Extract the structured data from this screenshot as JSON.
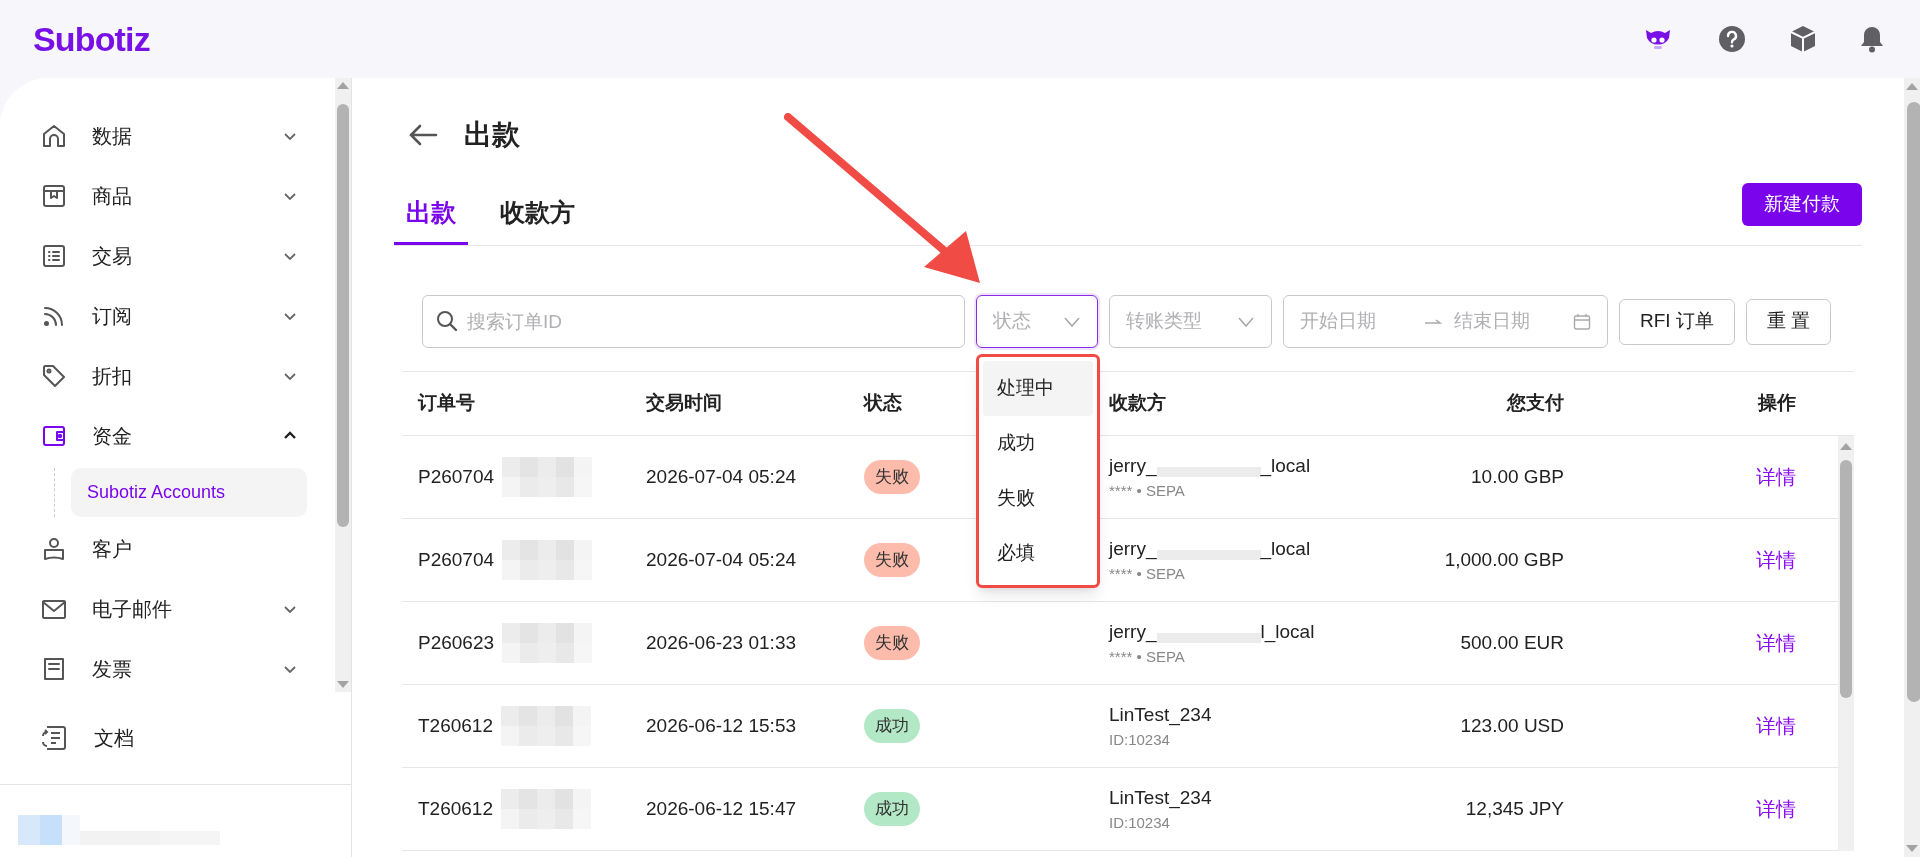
{
  "logo": "Subotiz",
  "sidebar": {
    "items": [
      {
        "label": "数据",
        "expandable": true,
        "expanded": false,
        "active": false
      },
      {
        "label": "商品",
        "expandable": true,
        "expanded": false,
        "active": false
      },
      {
        "label": "交易",
        "expandable": true,
        "expanded": false,
        "active": false
      },
      {
        "label": "订阅",
        "expandable": true,
        "expanded": false,
        "active": false
      },
      {
        "label": "折扣",
        "expandable": true,
        "expanded": false,
        "active": false
      },
      {
        "label": "资金",
        "expandable": true,
        "expanded": true,
        "active": true,
        "children": [
          {
            "label": "Subotiz Accounts",
            "selected": true
          }
        ]
      },
      {
        "label": "客户",
        "expandable": false,
        "active": false
      },
      {
        "label": "电子邮件",
        "expandable": true,
        "expanded": false,
        "active": false
      },
      {
        "label": "发票",
        "expandable": true,
        "expanded": false,
        "active": false
      }
    ],
    "footer_item": "文档"
  },
  "page": {
    "title": "出款",
    "tabs": [
      {
        "label": "出款",
        "selected": true
      },
      {
        "label": "收款方",
        "selected": false
      }
    ],
    "primary_button": "新建付款",
    "filters": {
      "search": {
        "placeholder": "搜索订单ID"
      },
      "status": {
        "placeholder": "状态",
        "open": true,
        "options": [
          {
            "label": "处理中",
            "highlighted": true
          },
          {
            "label": "成功",
            "highlighted": false
          },
          {
            "label": "失败",
            "highlighted": false
          },
          {
            "label": "必填",
            "highlighted": false
          }
        ]
      },
      "transfer_type": {
        "placeholder": "转账类型"
      },
      "date_range": {
        "start_placeholder": "开始日期",
        "end_placeholder": "结束日期"
      },
      "buttons": [
        "RFI 订单",
        "重 置"
      ]
    },
    "table": {
      "columns": [
        "订单号",
        "交易时间",
        "状态",
        "收款方",
        "您支付",
        "操作"
      ],
      "rows": [
        {
          "order_id": "P260704",
          "time": "2026-07-04 05:24",
          "status": {
            "label": "失败",
            "color": "#fdbcab"
          },
          "payee": {
            "parts": [
              "jerry_",
              "_local"
            ],
            "sub": "**** • SEPA"
          },
          "amount": "10.00 GBP",
          "action": "详情"
        },
        {
          "order_id": "P260704",
          "time": "2026-07-04 05:24",
          "status": {
            "label": "失败",
            "color": "#fdbcab"
          },
          "payee": {
            "parts": [
              "jerry_",
              "_local"
            ],
            "sub": "**** • SEPA"
          },
          "amount": "1,000.00 GBP",
          "action": "详情"
        },
        {
          "order_id": "P260623",
          "time": "2026-06-23 01:33",
          "status": {
            "label": "失败",
            "color": "#fdbcab"
          },
          "payee": {
            "parts": [
              "jerry_",
              "l_local"
            ],
            "sub": "**** • SEPA"
          },
          "amount": "500.00 EUR",
          "action": "详情"
        },
        {
          "order_id": "T260612",
          "time": "2026-06-12 15:53",
          "status": {
            "label": "成功",
            "color": "#b3e8c7"
          },
          "payee": {
            "parts": [
              "LinTest_234"
            ],
            "sub": "ID:10234"
          },
          "amount": "123.00 USD",
          "action": "详情"
        },
        {
          "order_id": "T260612",
          "time": "2026-06-12 15:47",
          "status": {
            "label": "成功",
            "color": "#b3e8c7"
          },
          "payee": {
            "parts": [
              "LinTest_234"
            ],
            "sub": "ID:10234"
          },
          "amount": "12,345 JPY",
          "action": "详情"
        }
      ]
    }
  }
}
